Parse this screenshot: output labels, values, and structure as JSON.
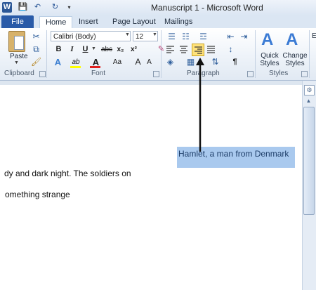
{
  "window": {
    "title": "Manuscript 1 - Microsoft Word",
    "app_logo_letter": "W"
  },
  "quick_access": {
    "save_icon": "💾",
    "undo_icon": "↶",
    "redo_icon": "↻"
  },
  "tabs": [
    {
      "label": "File"
    },
    {
      "label": "Home"
    },
    {
      "label": "Insert"
    },
    {
      "label": "Page Layout"
    },
    {
      "label": "Mailings"
    }
  ],
  "clipboard": {
    "paste_label": "Paste",
    "group_label": "Clipboard"
  },
  "font": {
    "name": "Calibri (Body)",
    "size": "12",
    "bold": "B",
    "italic": "I",
    "underline": "U",
    "strikethrough": "abc",
    "subscript": "x₂",
    "superscript": "x²",
    "text_effects": "A",
    "highlight": "ab",
    "font_color": "A",
    "change_case": "Aa",
    "grow": "A",
    "shrink": "A",
    "group_label": "Font"
  },
  "paragraph": {
    "group_label": "Paragraph",
    "show_marks": "¶"
  },
  "styles": {
    "quick_styles_label": "Quick Styles",
    "change_styles_label": "Change Styles",
    "group_label": "Styles",
    "edit_stub": "E"
  },
  "document": {
    "lines": [
      "Hamlet, a man from Denmark",
      "dy and dark night. The soldiers on",
      "omething strange"
    ],
    "selection_color": "#a9c9ee"
  },
  "accent": {
    "file_tab": "#2a5ba8",
    "active_align": "#ffe27a"
  }
}
